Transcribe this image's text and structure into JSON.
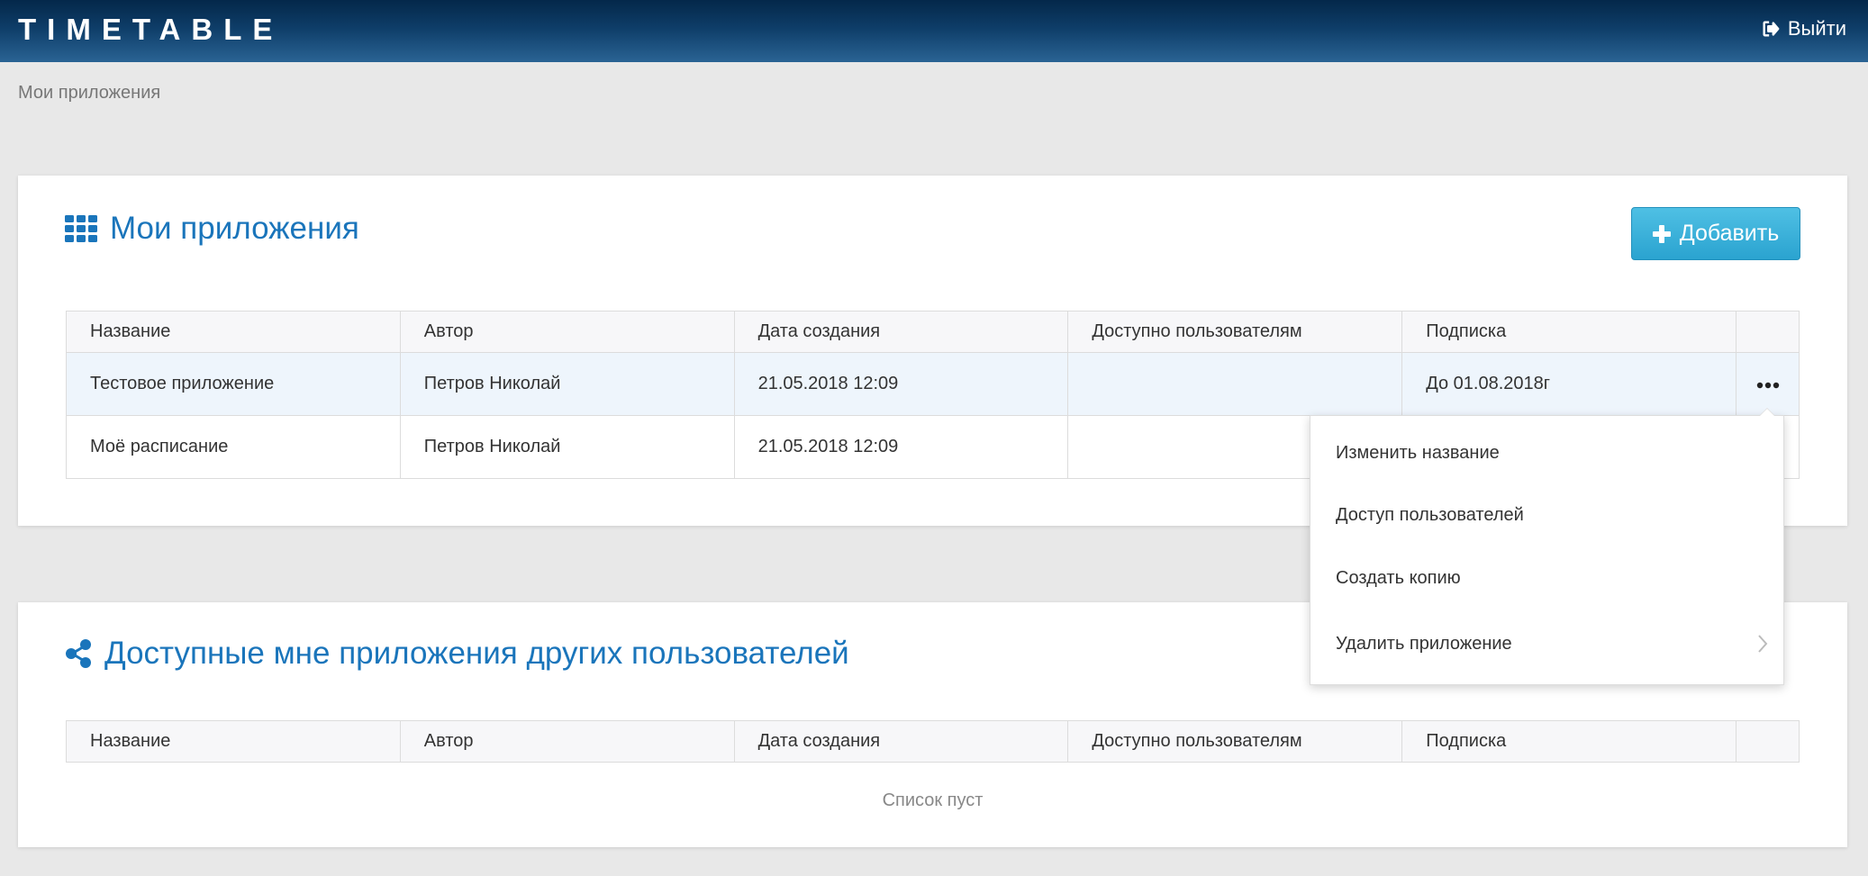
{
  "header": {
    "logo": "TIMETABLE",
    "logout_label": "Выйти",
    "logout_icon": "sign-out-icon"
  },
  "breadcrumb": "Мои приложения",
  "my_apps": {
    "title": "Мои приложения",
    "title_icon": "grid-icon",
    "add_label": "Добавить",
    "add_icon": "plus-icon",
    "columns": [
      "Название",
      "Автор",
      "Дата создания",
      "Доступно пользователям",
      "Подписка"
    ],
    "rows": [
      {
        "name": "Тестовое приложение",
        "author": "Петров Николай",
        "created": "21.05.2018 12:09",
        "shared": "",
        "subscription": "До 01.08.2018г"
      },
      {
        "name": "Моё расписание",
        "author": "Петров Николай",
        "created": "21.05.2018 12:09",
        "shared": "",
        "subscription": ""
      }
    ],
    "row_menu_icon": "ellipsis-icon"
  },
  "shared_apps": {
    "title": "Доступные мне приложения других пользователей",
    "title_icon": "share-icon",
    "columns": [
      "Название",
      "Автор",
      "Дата создания",
      "Доступно пользователям",
      "Подписка"
    ],
    "empty_text": "Список пуст"
  },
  "context_menu": {
    "items": [
      "Изменить название",
      "Доступ пользователей",
      "Создать копию",
      "Удалить приложение"
    ]
  },
  "colors": {
    "accent": "#1a75bb",
    "header_dark": "#04284a",
    "button": "#2aa3d0"
  }
}
